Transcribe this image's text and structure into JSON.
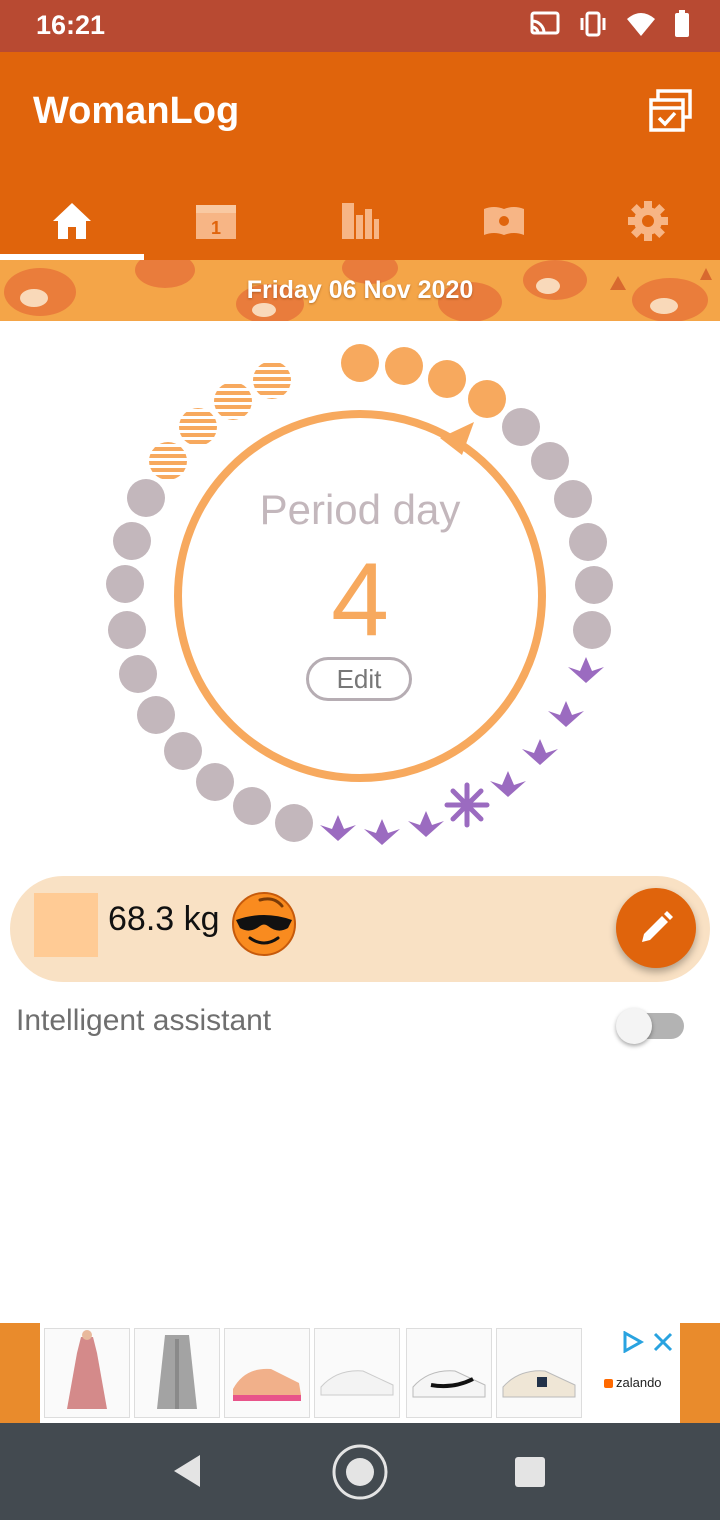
{
  "status_bar": {
    "time": "16:21"
  },
  "app_bar": {
    "title": "WomanLog"
  },
  "tabs": [
    {
      "name": "home",
      "icon": "home-icon",
      "selected": true
    },
    {
      "name": "calendar",
      "icon": "calendar-icon",
      "badge": "1"
    },
    {
      "name": "statistics",
      "icon": "chart-icon"
    },
    {
      "name": "info",
      "icon": "book-icon"
    },
    {
      "name": "settings",
      "icon": "gear-icon"
    }
  ],
  "date_banner": {
    "text": "Friday 06 Nov 2020"
  },
  "cycle": {
    "period_label": "Period day",
    "day_number": "4",
    "edit_label": "Edit",
    "colors": {
      "period": "#f7a95e",
      "neutral": "#c3b7bc",
      "fertile": "#9b6bc0",
      "ring": "#f7a95e"
    }
  },
  "weight": {
    "value": "68.3 kg",
    "mood_icon": "sunglasses-emoji-icon"
  },
  "assistant": {
    "label": "Intelligent assistant",
    "enabled": false
  },
  "ad": {
    "brand": "zalando"
  },
  "colors": {
    "accent": "#e0640c",
    "status_bar": "#b84a32",
    "banner": "#f4a548"
  }
}
